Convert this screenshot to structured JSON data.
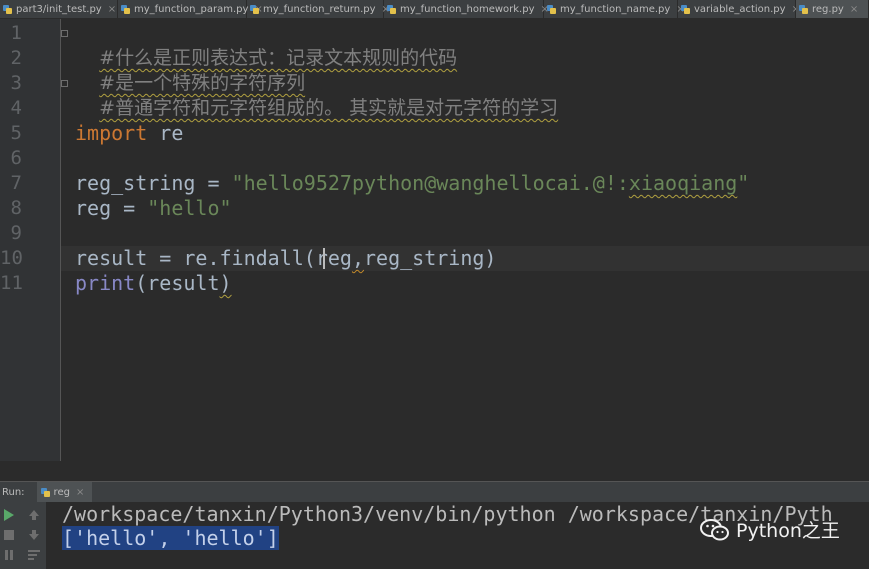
{
  "tabs": [
    {
      "label": "part3/init_test.py",
      "active": false,
      "width": 118
    },
    {
      "label": "my_function_param.py",
      "active": false,
      "width": 129
    },
    {
      "label": "my_function_return.py",
      "active": false,
      "width": 137
    },
    {
      "label": "my_function_homework.py",
      "active": false,
      "width": 160
    },
    {
      "label": "my_function_name.py",
      "active": false,
      "width": 134
    },
    {
      "label": "variable_action.py",
      "active": false,
      "width": 118
    },
    {
      "label": "reg.py",
      "active": true,
      "width": 73
    }
  ],
  "editor": {
    "line_numbers": [
      "1",
      "2",
      "3",
      "4",
      "5",
      "6",
      "7",
      "8",
      "9",
      "10",
      "11"
    ],
    "line1": "#什么是正则表达式：记录文本规则的代码",
    "line2": "#是一个特殊的字符序列",
    "line3": "#普通字符和元字符组成的。 其实就是对元字符的学习",
    "line5": {
      "kw": "import",
      "rest": " re"
    },
    "line7": {
      "lhs": "reg_string = ",
      "str_open": "\"hello9527python@wanghellocai.@!:",
      "str_wavy": "xiaoqiang",
      "str_close": "\""
    },
    "line8": {
      "lhs": "reg = ",
      "str": "\"hello\""
    },
    "line10": {
      "a": "result = re.findall(",
      "b": "reg",
      "c": ",",
      "d": "reg_string)"
    },
    "line11": {
      "fn": "print",
      "a": "(result",
      "b": ")"
    }
  },
  "run": {
    "label": "Run:",
    "tab_label": "reg",
    "command_line": "/workspace/tanxin/Python3/venv/bin/python /workspace/tanxin/Pyth",
    "output_line": "['hello', 'hello']"
  },
  "watermark": {
    "text": "Python之王"
  },
  "colors": {
    "keyword": "#cc7832",
    "string": "#6a8759",
    "comment": "#808080",
    "builtin": "#8888c6",
    "selection": "#214283"
  }
}
